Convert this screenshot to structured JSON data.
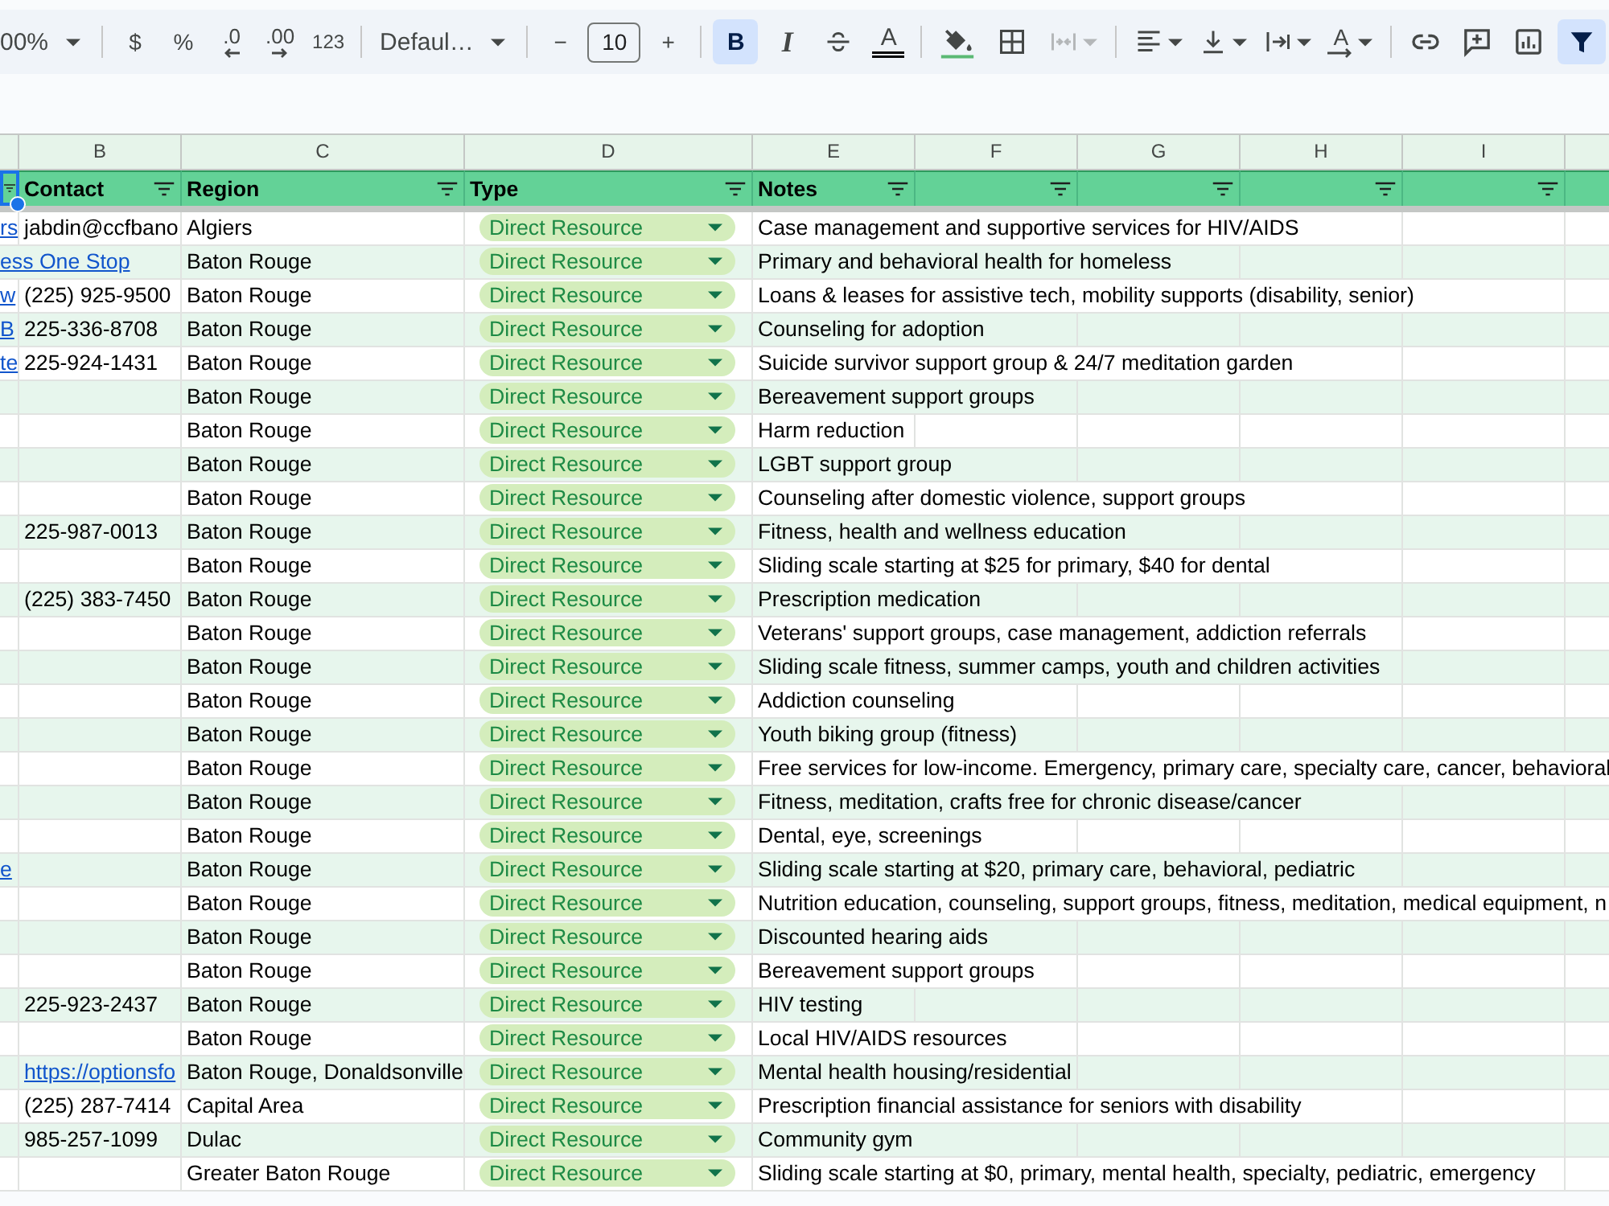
{
  "toolbar": [
    {
      "kind": "dropdown",
      "label": "00%",
      "selected": false,
      "disabled": false
    },
    {
      "kind": "divider"
    },
    {
      "kind": "text",
      "label": "$",
      "selected": false,
      "disabled": false
    },
    {
      "kind": "text",
      "label": "%",
      "selected": false,
      "disabled": false
    },
    {
      "kind": "decrease-decimal",
      "label": ".0",
      "selected": false,
      "disabled": false
    },
    {
      "kind": "increase-decimal",
      "label": ".00",
      "selected": false,
      "disabled": false
    },
    {
      "kind": "text",
      "label": "123",
      "selected": false,
      "disabled": false
    },
    {
      "kind": "divider"
    },
    {
      "kind": "dropdown",
      "label": "Defaul…",
      "selected": false,
      "disabled": false
    },
    {
      "kind": "divider"
    },
    {
      "kind": "text",
      "label": "−",
      "selected": false,
      "disabled": false
    },
    {
      "kind": "size",
      "value": "10"
    },
    {
      "kind": "text",
      "label": "+",
      "selected": false,
      "disabled": false
    },
    {
      "kind": "divider"
    },
    {
      "kind": "bold",
      "label": "B",
      "selected": true,
      "disabled": false
    },
    {
      "kind": "italic",
      "label": "I",
      "selected": false,
      "disabled": false
    },
    {
      "kind": "strikethrough",
      "selected": false,
      "disabled": false
    },
    {
      "kind": "text-color",
      "label": "A",
      "selected": false,
      "disabled": false
    },
    {
      "kind": "divider"
    },
    {
      "kind": "fill-color",
      "selected": false,
      "disabled": false
    },
    {
      "kind": "borders",
      "selected": false,
      "disabled": false
    },
    {
      "kind": "merge",
      "selected": false,
      "disabled": true
    },
    {
      "kind": "divider"
    },
    {
      "kind": "align",
      "selected": false,
      "disabled": false
    },
    {
      "kind": "valign",
      "selected": false,
      "disabled": false
    },
    {
      "kind": "wrap",
      "selected": false,
      "disabled": false
    },
    {
      "kind": "rotate",
      "label": "A",
      "selected": false,
      "disabled": false
    },
    {
      "kind": "divider"
    },
    {
      "kind": "link",
      "selected": false,
      "disabled": false
    },
    {
      "kind": "comment",
      "selected": false,
      "disabled": false
    },
    {
      "kind": "chart",
      "selected": false,
      "disabled": false
    },
    {
      "kind": "filter",
      "selected": true,
      "disabled": false
    }
  ],
  "columns": [
    {
      "selected": true,
      "filter": true
    },
    {
      "letter": "B",
      "header": "Contact",
      "selected": false,
      "filter": true
    },
    {
      "letter": "C",
      "header": "Region",
      "selected": false,
      "filter": true
    },
    {
      "letter": "D",
      "header": "Type",
      "selected": false,
      "filter": true
    },
    {
      "letter": "E",
      "header": "Notes",
      "selected": false,
      "filter": true
    },
    {
      "letter": "F",
      "selected": false,
      "filter": true
    },
    {
      "letter": "G",
      "selected": false,
      "filter": true
    },
    {
      "letter": "H",
      "selected": false,
      "filter": true
    },
    {
      "letter": "I",
      "selected": false,
      "filter": true
    },
    {
      "selected": false,
      "filter": false
    }
  ],
  "rows": [
    {
      "column_a": {
        "text": "rs",
        "link": true
      },
      "contact": {
        "text": "jabdin@ccfbano",
        "link": false
      },
      "region": "Algiers",
      "type": "Direct Resource",
      "notes": "Case management and supportive services for HIV/AIDS"
    },
    {
      "column_a": {
        "text": "ess One Stop",
        "link": true
      },
      "region": "Baton Rouge",
      "type": "Direct Resource",
      "notes": "Primary and behavioral health for homeless"
    },
    {
      "column_a": {
        "text": "w",
        "link": true
      },
      "contact": {
        "text": "(225) 925-9500",
        "link": false
      },
      "region": "Baton Rouge",
      "type": "Direct Resource",
      "notes": "Loans & leases for assistive tech, mobility supports (disability, senior)"
    },
    {
      "column_a": {
        "text": "B",
        "link": true
      },
      "contact": {
        "text": "225-336-8708",
        "link": false
      },
      "region": "Baton Rouge",
      "type": "Direct Resource",
      "notes": "Counseling for adoption"
    },
    {
      "column_a": {
        "text": "te",
        "link": true
      },
      "contact": {
        "text": "225-924-1431",
        "link": false
      },
      "region": "Baton Rouge",
      "type": "Direct Resource",
      "notes": "Suicide survivor support group & 24/7 meditation garden"
    },
    {
      "region": "Baton Rouge",
      "type": "Direct Resource",
      "notes": "Bereavement support groups"
    },
    {
      "region": "Baton Rouge",
      "type": "Direct Resource",
      "notes": "Harm reduction"
    },
    {
      "region": "Baton Rouge",
      "type": "Direct Resource",
      "notes": "LGBT support group"
    },
    {
      "region": "Baton Rouge",
      "type": "Direct Resource",
      "notes": "Counseling after domestic violence, support groups"
    },
    {
      "contact": {
        "text": "225-987-0013",
        "link": false
      },
      "region": "Baton Rouge",
      "type": "Direct Resource",
      "notes": "Fitness, health and wellness education"
    },
    {
      "region": "Baton Rouge",
      "type": "Direct Resource",
      "notes": "Sliding scale starting at $25 for primary, $40 for dental"
    },
    {
      "contact": {
        "text": "(225) 383-7450",
        "link": false
      },
      "region": "Baton Rouge",
      "type": "Direct Resource",
      "notes": "Prescription medication"
    },
    {
      "region": "Baton Rouge",
      "type": "Direct Resource",
      "notes": "Veterans' support groups, case management, addiction referrals"
    },
    {
      "region": "Baton Rouge",
      "type": "Direct Resource",
      "notes": "Sliding scale fitness, summer camps, youth and children activities"
    },
    {
      "region": "Baton Rouge",
      "type": "Direct Resource",
      "notes": "Addiction counseling"
    },
    {
      "region": "Baton Rouge",
      "type": "Direct Resource",
      "notes": "Youth biking group (fitness)"
    },
    {
      "region": "Baton Rouge",
      "type": "Direct Resource",
      "notes": "Free services for low-income. Emergency, primary care, specialty care, cancer, behavioral"
    },
    {
      "region": "Baton Rouge",
      "type": "Direct Resource",
      "notes": "Fitness, meditation, crafts free for chronic disease/cancer"
    },
    {
      "region": "Baton Rouge",
      "type": "Direct Resource",
      "notes": "Dental, eye, screenings"
    },
    {
      "column_a": {
        "text": "e",
        "link": true
      },
      "region": "Baton Rouge",
      "type": "Direct Resource",
      "notes": "Sliding scale starting at $20, primary care, behavioral, pediatric"
    },
    {
      "region": "Baton Rouge",
      "type": "Direct Resource",
      "notes": "Nutrition education, counseling, support groups, fitness, meditation, medical equipment, n"
    },
    {
      "region": "Baton Rouge",
      "type": "Direct Resource",
      "notes": "Discounted hearing aids"
    },
    {
      "region": "Baton Rouge",
      "type": "Direct Resource",
      "notes": "Bereavement support groups"
    },
    {
      "contact": {
        "text": "225-923-2437",
        "link": false
      },
      "region": "Baton Rouge",
      "type": "Direct Resource",
      "notes": "HIV testing"
    },
    {
      "region": "Baton Rouge",
      "type": "Direct Resource",
      "notes": "Local HIV/AIDS resources"
    },
    {
      "contact": {
        "text": "https://optionsfo",
        "link": true
      },
      "region": "Baton Rouge, Donaldsonville",
      "type": "Direct Resource",
      "notes": "Mental health housing/residential"
    },
    {
      "contact": {
        "text": "(225) 287-7414",
        "link": false
      },
      "region": "Capital Area",
      "type": "Direct Resource",
      "notes": "Prescription financial assistance for seniors with disability"
    },
    {
      "contact": {
        "text": "985-257-1099",
        "link": false
      },
      "region": "Dulac",
      "type": "Direct Resource",
      "notes": "Community gym"
    },
    {
      "region": "Greater Baton Rouge",
      "type": "Direct Resource",
      "notes": "Sliding scale starting at $0, primary, mental health, specialty, pediatric, emergency"
    }
  ]
}
